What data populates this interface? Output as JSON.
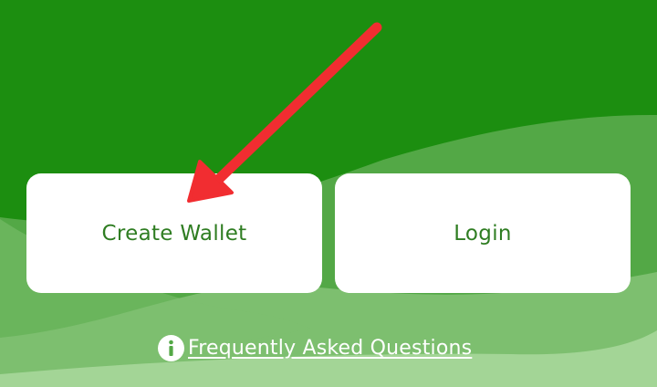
{
  "buttons": {
    "create_wallet": "Create Wallet",
    "login": "Login"
  },
  "faq": {
    "label": "Frequently Asked Questions",
    "icon": "info-icon"
  },
  "annotation": {
    "arrow_icon": "red-arrow-icon",
    "color": "#f12d31"
  },
  "colors": {
    "background_dark": "#1c8e10",
    "wave_mid": "#53a846",
    "wave_light": "#7dbf6f",
    "wave_lightest": "#a3d596",
    "button_text": "#2f7d22"
  }
}
